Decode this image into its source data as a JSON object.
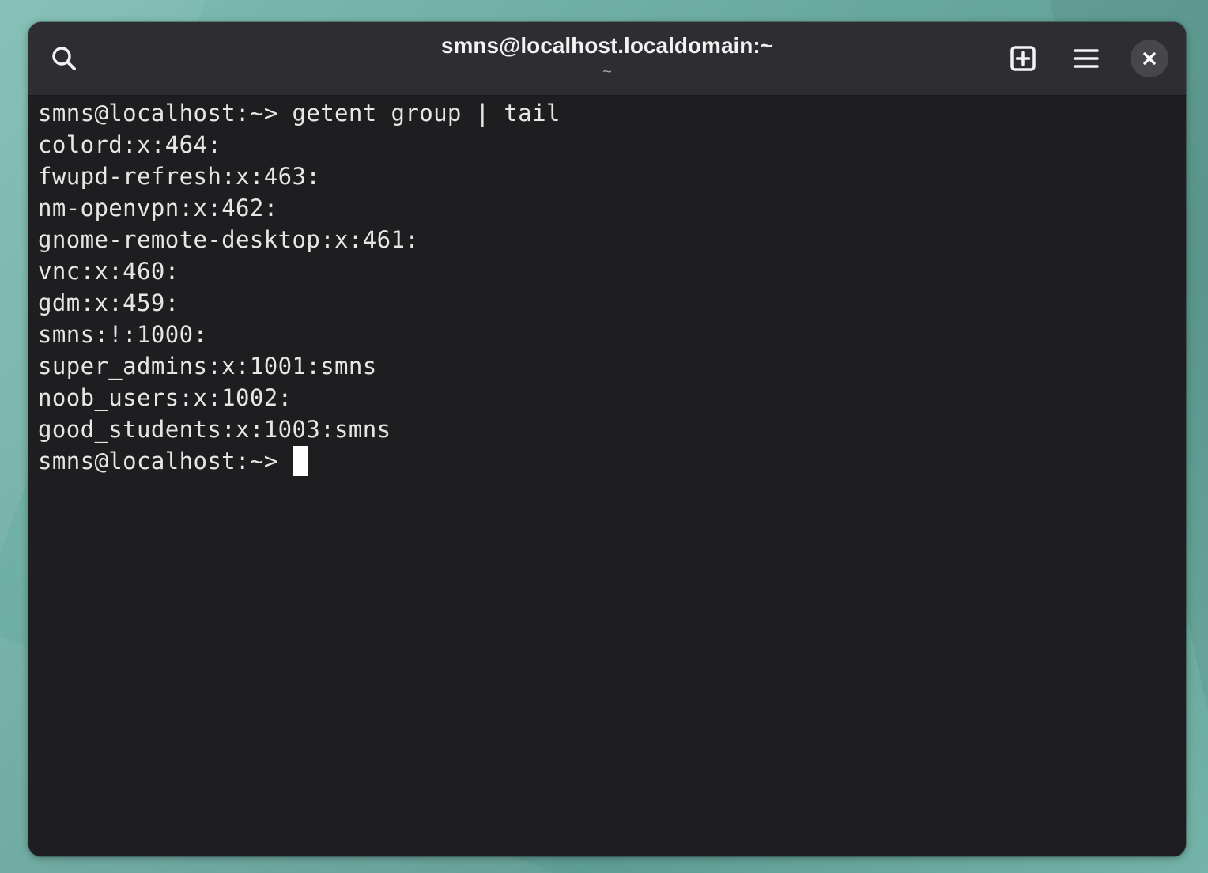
{
  "window": {
    "title": "smns@localhost.localdomain:~",
    "subtitle": "~"
  },
  "headerbar": {
    "search_icon": "search-icon",
    "new_tab_icon": "new-tab-icon",
    "menu_icon": "hamburger-menu-icon",
    "close_icon": "close-icon"
  },
  "terminal": {
    "lines": [
      "smns@localhost:~> getent group | tail",
      "colord:x:464:",
      "fwupd-refresh:x:463:",
      "nm-openvpn:x:462:",
      "gnome-remote-desktop:x:461:",
      "vnc:x:460:",
      "gdm:x:459:",
      "smns:!:1000:",
      "super_admins:x:1001:smns",
      "noob_users:x:1002:",
      "good_students:x:1003:smns"
    ],
    "prompt": "smns@localhost:~> "
  },
  "colors": {
    "headerbar": "#2e2e32",
    "terminal_bg": "#1e1e21",
    "text": "#e6e6e6",
    "desktop": "#6aa99f"
  }
}
